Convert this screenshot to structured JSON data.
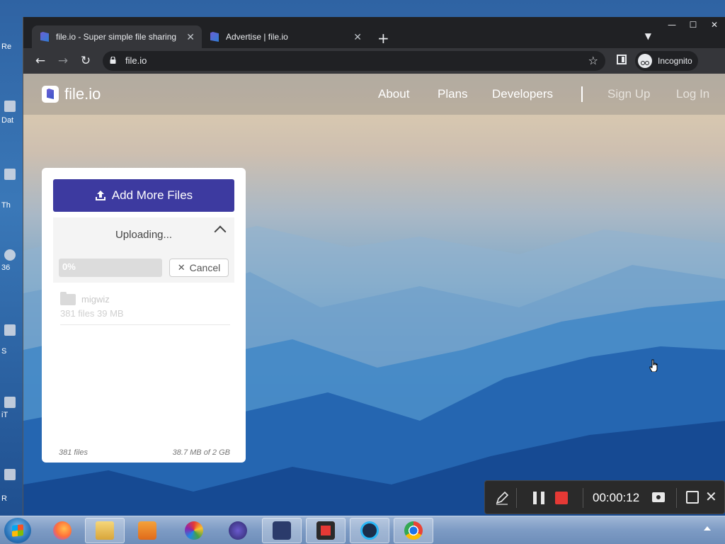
{
  "desktop": {
    "labels": [
      "Re",
      "Dat",
      "Th",
      "36",
      "S",
      "iT",
      "R"
    ]
  },
  "browser": {
    "tabs": [
      {
        "title": "file.io - Super simple file sharing",
        "active": true
      },
      {
        "title": "Advertise | file.io",
        "active": false
      }
    ],
    "new_tab_label": "+",
    "url": "file.io",
    "incognito_label": "Incognito",
    "window_controls": {
      "minimize": "—",
      "maximize": "☐",
      "close": "✕"
    }
  },
  "site": {
    "logo_text": "file.io",
    "nav": {
      "about": "About",
      "plans": "Plans",
      "developers": "Developers",
      "signup": "Sign Up",
      "login": "Log In"
    }
  },
  "upload": {
    "add_button_label": "Add More Files",
    "status_text": "Uploading...",
    "progress_label": "0%",
    "progress_value": 0,
    "cancel_label": "Cancel",
    "item": {
      "name": "migwiz",
      "meta": "381 files 39 MB"
    },
    "footer_count": "381 files",
    "footer_size": "38.7 MB of 2 GB"
  },
  "recorder": {
    "timer": "00:00:12"
  },
  "colors": {
    "brand": "#3d3aa0",
    "record_stop": "#e53935",
    "browser_chrome": "#202124"
  },
  "icons": {
    "taskbar": [
      "windows-start-icon",
      "firefox-icon",
      "file-explorer-icon",
      "media-player-icon",
      "photos-icon",
      "generic-app-icon",
      "screen-share-icon",
      "screen-recorder-icon",
      "ccleaner-icon",
      "chrome-icon"
    ]
  }
}
